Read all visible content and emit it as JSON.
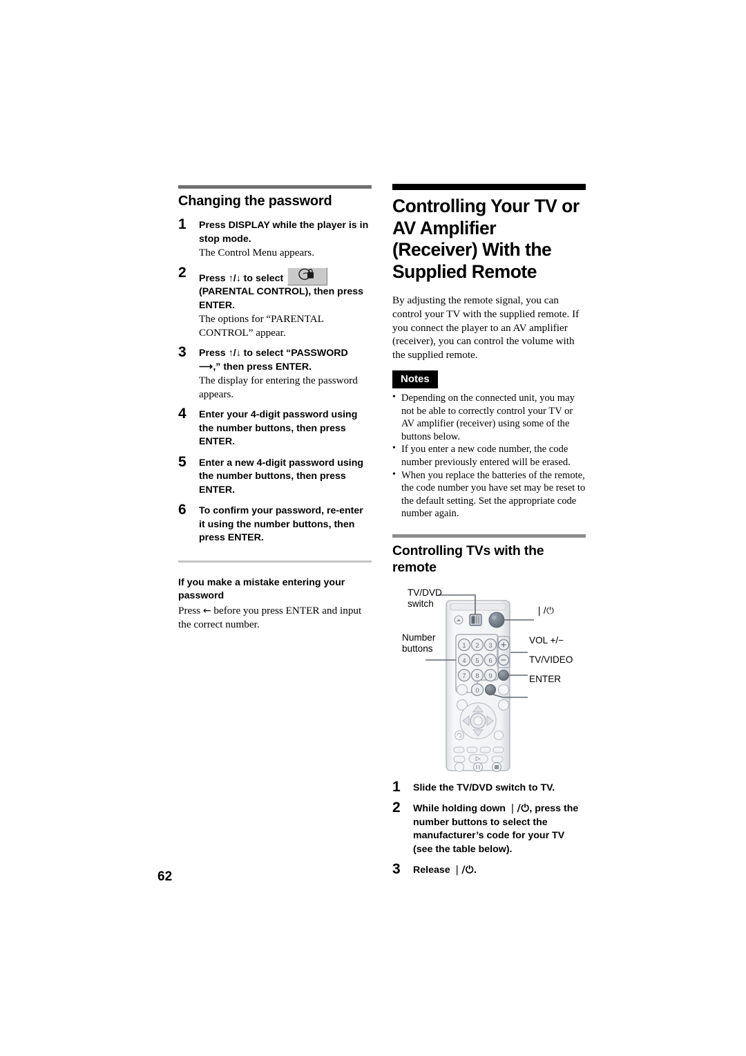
{
  "page": {
    "number": "62"
  },
  "left_column": {
    "heading": "Changing the password",
    "steps": [
      {
        "num": "1",
        "bold": "Press DISPLAY while the player is in stop mode.",
        "body": "The Control Menu appears."
      },
      {
        "num": "2",
        "bold_before": "Press ↑/↓ to select",
        "icon_name": "parental-control-icon",
        "bold_after": "(PARENTAL CONTROL), then press ENTER.",
        "body": "The options for “PARENTAL CONTROL” appear."
      },
      {
        "num": "3",
        "bold": "Press ↑/↓ to select “PASSWORD ⟶,” then press ENTER.",
        "body": "The display for entering the password appears."
      },
      {
        "num": "4",
        "bold": "Enter your 4-digit password using the number buttons, then press ENTER.",
        "body": ""
      },
      {
        "num": "5",
        "bold": "Enter a new 4-digit password using the number buttons, then press ENTER.",
        "body": ""
      },
      {
        "num": "6",
        "bold": "To confirm your password, re-enter it using the number buttons, then press ENTER.",
        "body": ""
      }
    ],
    "tip": {
      "heading": "If you make a mistake entering your password",
      "body_before": "Press ",
      "arrow": "←",
      "body_after": " before you press ENTER and input the correct number."
    }
  },
  "right_column": {
    "title": "Controlling Your TV or AV Amplifier (Receiver) With the Supplied Remote",
    "intro": "By adjusting the remote signal, you can control your TV with the supplied remote. If you connect the player to an AV amplifier (receiver), you can control the volume with the supplied remote.",
    "notes": {
      "badge": "Notes",
      "items": [
        "Depending on the connected unit, you may not be able to correctly control your TV or AV amplifier (receiver) using some of the buttons below.",
        "If you enter a new code number, the code number previously entered will be erased.",
        "When you replace the batteries of the remote, the code number you have set may be reset to the default setting. Set the appropriate code number again."
      ]
    },
    "subheading": "Controlling TVs with the remote",
    "remote_figure": {
      "labels": {
        "tvdvd_switch": "TV/DVD\nswitch",
        "tvdvd_switch_line1": "TV/DVD",
        "tvdvd_switch_line2": "switch",
        "number_buttons_line1": "Number",
        "number_buttons_line2": "buttons",
        "power": "❘/⏻",
        "volume": "VOL +/−",
        "tv_video": "TV/VIDEO",
        "enter": "ENTER"
      },
      "number_keys": [
        "1",
        "2",
        "3",
        "4",
        "5",
        "6",
        "7",
        "8",
        "9",
        "0"
      ]
    },
    "steps": [
      {
        "num": "1",
        "bold": "Slide the TV/DVD switch to TV."
      },
      {
        "num": "2",
        "bold_before": "While holding down ",
        "symbol": "❘/⏻",
        "bold_after": ", press the number buttons to select the manufacturer’s code for your TV (see the table below)."
      },
      {
        "num": "3",
        "bold_before": "Release ",
        "symbol": "❘/⏻",
        "bold_after": "."
      }
    ]
  },
  "colors": {
    "page_background": "#ffffff",
    "text": "#000000",
    "rule_grey": "#6f6f6f",
    "rule_black": "#000000",
    "rule_light": "#c3c3c3",
    "notes_badge_bg": "#000000",
    "notes_badge_text": "#ffffff",
    "remote_body": "#f2f2f2",
    "remote_outline": "#9aa0aa",
    "remote_button_dark": "#6e7680"
  }
}
